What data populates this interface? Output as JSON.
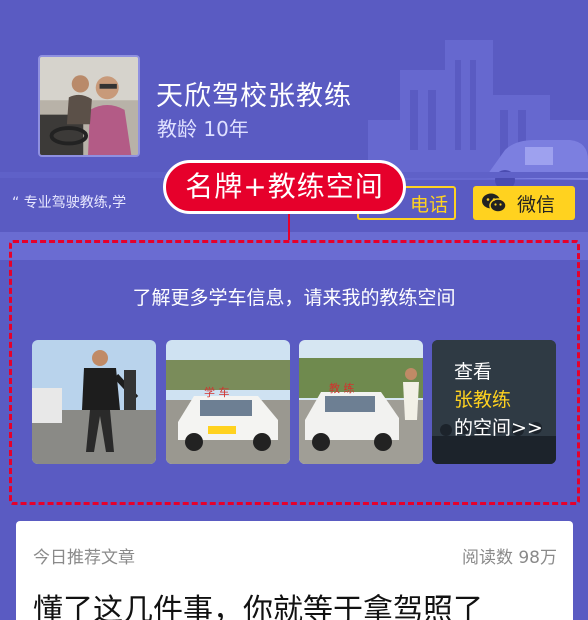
{
  "header": {
    "coach_name": "天欣驾校张教练",
    "teaching_years": "教龄 10年",
    "quote": "“ 专业驾驶教练,学",
    "avatar_icon": "coach-photo"
  },
  "annotation": {
    "callout_label": "名牌+教练空间",
    "color": "#e6002b"
  },
  "actions": {
    "phone_label": "电话",
    "wechat_label": "微信",
    "accent": "#ffd21f"
  },
  "coach_space": {
    "title": "了解更多学车信息，请来我的教练空间",
    "photos": [
      {
        "icon": "coach-photo-1"
      },
      {
        "icon": "car-photo-2"
      },
      {
        "icon": "car-photo-3"
      }
    ],
    "more": {
      "line1": "查看",
      "line2": "张教练",
      "line3": "的空间>>"
    }
  },
  "article": {
    "label": "今日推荐文章",
    "reads": "阅读数 98万",
    "title": "懂了这几件事，你就等于拿驾照了"
  },
  "colors": {
    "background": "#5a5bc2",
    "panel": "#6a6cd2"
  }
}
